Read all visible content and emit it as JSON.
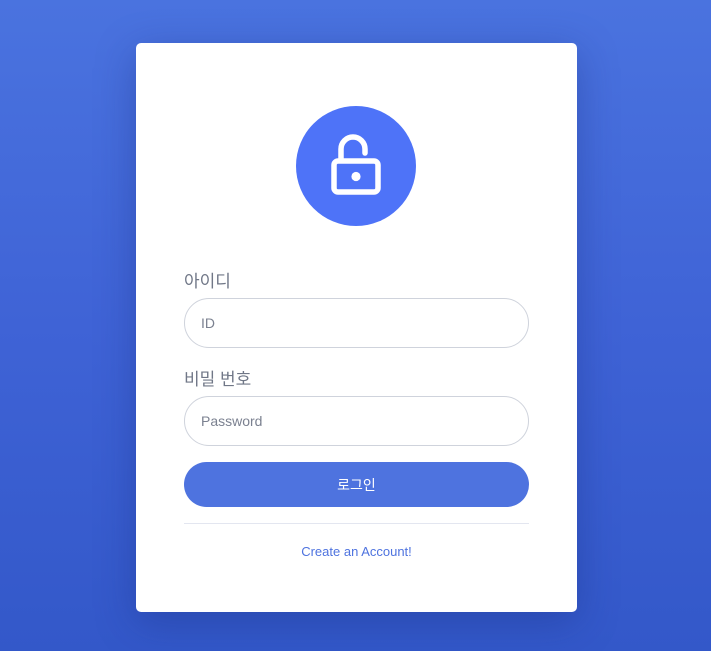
{
  "login": {
    "icon": "unlock-icon",
    "id_label": "아이디",
    "id_placeholder": "ID",
    "id_value": "",
    "password_label": "비밀 번호",
    "password_placeholder": "Password",
    "password_value": "",
    "submit_label": "로그인",
    "create_account_link": "Create an Account!"
  },
  "colors": {
    "background": "#4269d9",
    "accent": "#4e73df",
    "icon_circle": "#4e73f8",
    "card": "#ffffff"
  }
}
